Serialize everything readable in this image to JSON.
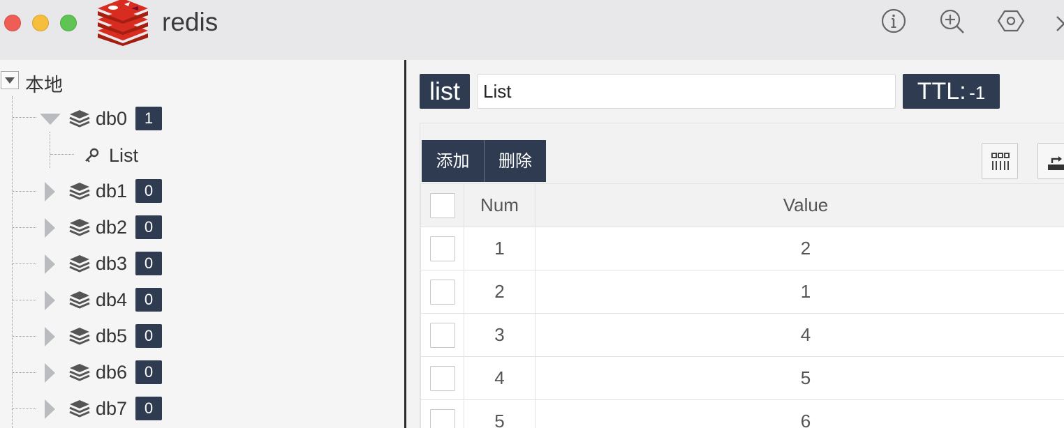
{
  "window": {
    "title": "redis",
    "controls": [
      "close",
      "minimize",
      "maximize"
    ],
    "toolbar_icons": [
      "info-icon",
      "zoom-in-icon",
      "settings-hex-icon",
      "expand-icon"
    ]
  },
  "sidebar": {
    "root_label": "本地",
    "databases": [
      {
        "label": "db0",
        "count": "1",
        "expanded": true
      },
      {
        "label": "db1",
        "count": "0",
        "expanded": false
      },
      {
        "label": "db2",
        "count": "0",
        "expanded": false
      },
      {
        "label": "db3",
        "count": "0",
        "expanded": false
      },
      {
        "label": "db4",
        "count": "0",
        "expanded": false
      },
      {
        "label": "db5",
        "count": "0",
        "expanded": false
      },
      {
        "label": "db6",
        "count": "0",
        "expanded": false
      },
      {
        "label": "db7",
        "count": "0",
        "expanded": false
      }
    ],
    "keys": [
      {
        "label": "List"
      }
    ]
  },
  "detail": {
    "type": "list",
    "key_name": "List",
    "ttl_label": "TTL:",
    "ttl_value": "-1"
  },
  "actions": {
    "add": "添加",
    "delete": "删除"
  },
  "table": {
    "columns": [
      "Num",
      "Value"
    ],
    "rows": [
      {
        "num": "1",
        "value": "2"
      },
      {
        "num": "2",
        "value": "1"
      },
      {
        "num": "3",
        "value": "4"
      },
      {
        "num": "4",
        "value": "5"
      },
      {
        "num": "5",
        "value": "6"
      }
    ]
  },
  "colors": {
    "badge": "#2f3b50",
    "titlebar": "#e8e8eb",
    "sidebar": "#f5f5f5"
  }
}
